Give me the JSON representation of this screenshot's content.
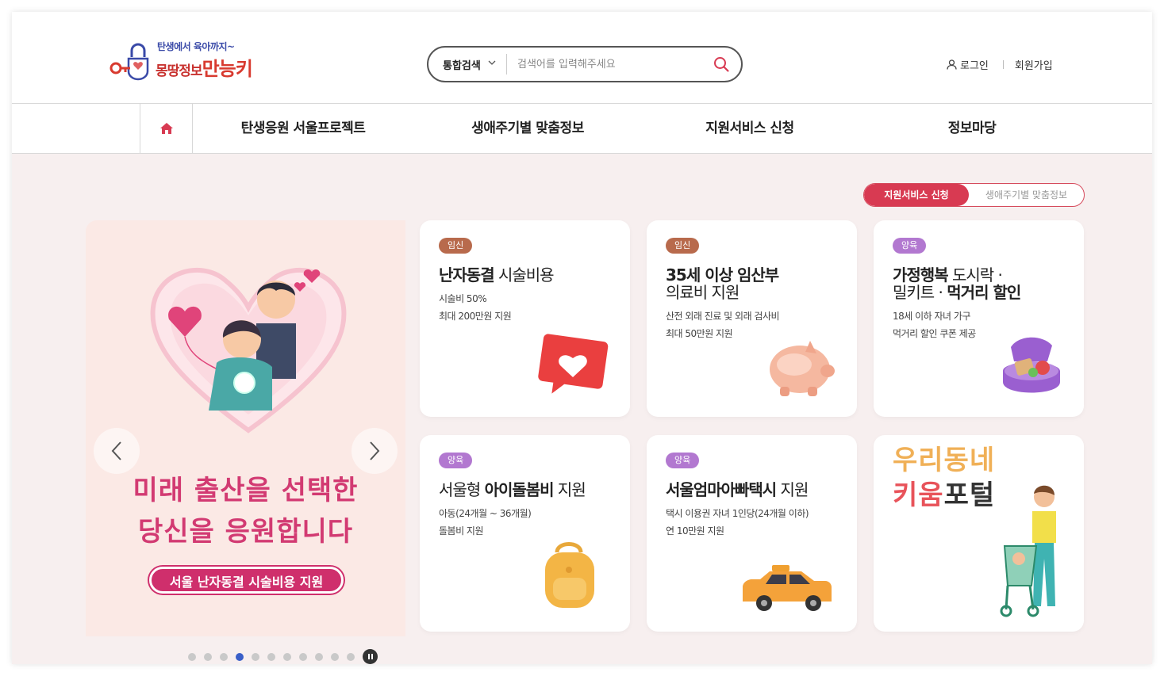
{
  "header": {
    "logo_sub": "탄생에서 육아까지~",
    "logo_main": "몽땅정보",
    "logo_accent": "만능키",
    "search": {
      "category": "통합검색",
      "placeholder": "검색어를 입력해주세요"
    },
    "login_label": "로그인",
    "signup_label": "회원가입"
  },
  "nav": {
    "items": [
      {
        "label": "탄생응원 서울프로젝트"
      },
      {
        "label": "생애주기별 맞춤정보"
      },
      {
        "label": "지원서비스 신청"
      },
      {
        "label": "정보마당"
      }
    ]
  },
  "toggle": {
    "active": "지원서비스 신청",
    "inactive": "생애주기별 맞춤정보"
  },
  "banner": {
    "line1": "미래 출산을 선택한",
    "line2": "당신을 응원합니다",
    "pill": "서울 난자동결 시술비용 지원",
    "slide_count": 12,
    "active_slide": 4
  },
  "cards": [
    {
      "badge": "임신",
      "title_bold": "난자동결",
      "title_rest": " 시술비용",
      "desc1": "시술비 50%",
      "desc2": "최대 200만원 지원"
    },
    {
      "badge": "임신",
      "title_bold": "35세 이상 임산부",
      "title_rest": "의료비 지원",
      "desc1": "산전 외래 진료 및 외래 검사비",
      "desc2": "최대 50만원 지원"
    },
    {
      "badge": "양육",
      "title_bold": "가정행복",
      "title_mid": " 도시락 ·",
      "title_line2a": "밀키트 · ",
      "title_line2b": "먹거리 할인",
      "desc1": "18세 이하 자녀 가구",
      "desc2": "먹거리 할인 쿠폰 제공"
    },
    {
      "badge": "양육",
      "title_pre": "서울형 ",
      "title_bold": "아이돌봄비",
      "title_rest": " 지원",
      "desc1": "아동(24개월 ~ 36개월)",
      "desc2": "돌봄비 지원"
    },
    {
      "badge": "양육",
      "title_bold": "서울엄마아빠택시",
      "title_rest": " 지원",
      "desc1": "택시 이용권 자녀 1인당(24개월 이하)",
      "desc2": "연 10만원 지원"
    }
  ],
  "kiwoom": {
    "line1": "우리동네",
    "line2a": "키움",
    "line2b": "포털"
  },
  "colors": {
    "brand_red": "#d83a52",
    "badge_pregnancy": "#b86a4c",
    "badge_parenting": "#b278d0",
    "banner_text": "#d23a72",
    "active_dot": "#3a5fc8"
  }
}
